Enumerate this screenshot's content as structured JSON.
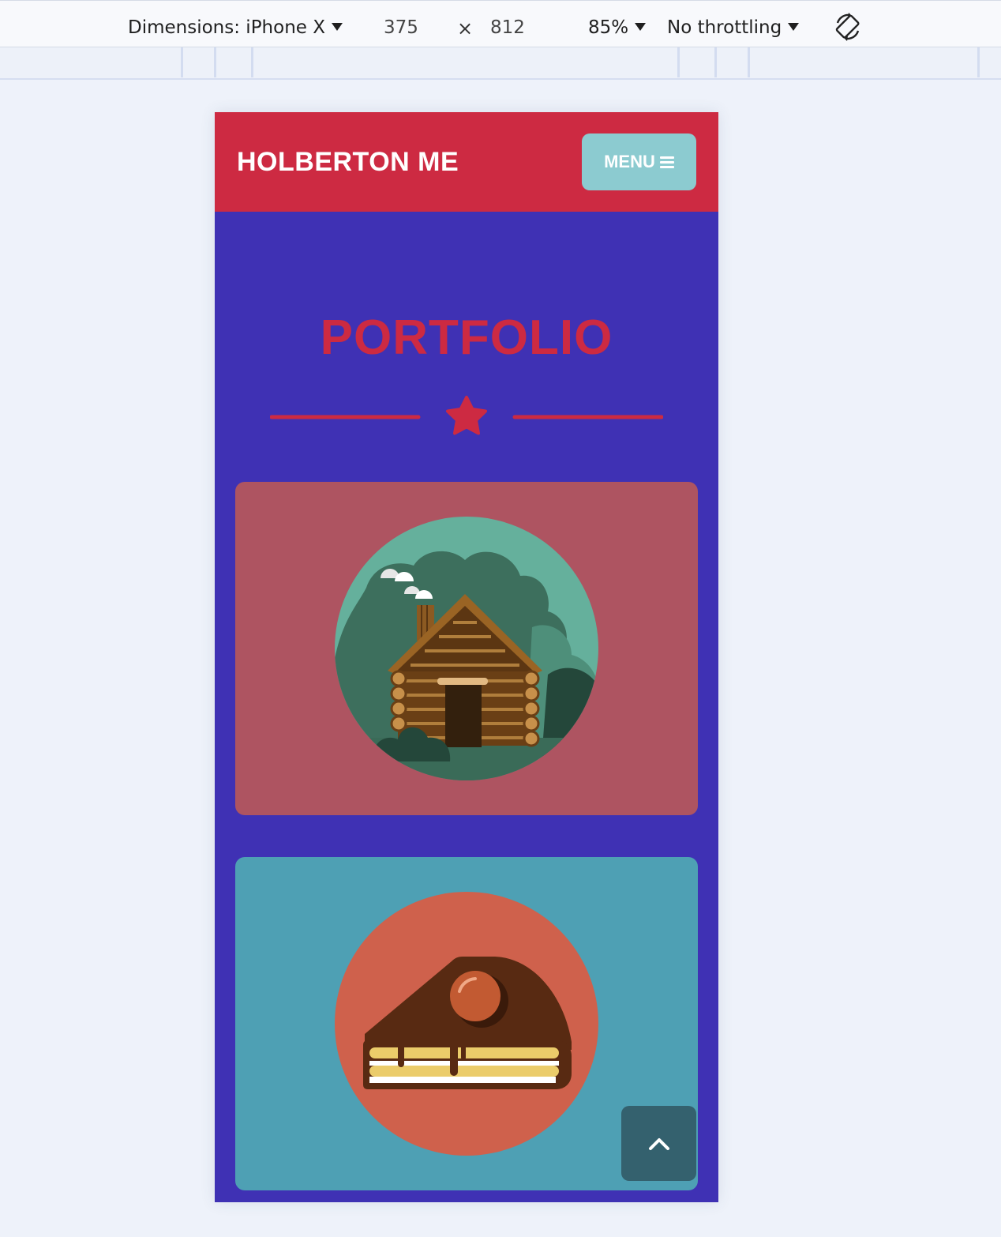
{
  "devtools": {
    "dimensions_label": "Dimensions: iPhone X",
    "width": "375",
    "height": "812",
    "times": "×",
    "zoom": "85%",
    "throttling": "No throttling"
  },
  "site": {
    "brand": "HOLBERTON ME",
    "menu_label": "MENU",
    "section_title": "PORTFOLIO",
    "cards": [
      {
        "name": "log-cabin",
        "background": "#ae5461"
      },
      {
        "name": "cake-slice",
        "background": "#4ea0b4"
      }
    ]
  },
  "colors": {
    "header": "#cd2a42",
    "page": "#3f31b4",
    "menu_button": "#8ccbd0",
    "scroll_top_button": "#34616e"
  }
}
